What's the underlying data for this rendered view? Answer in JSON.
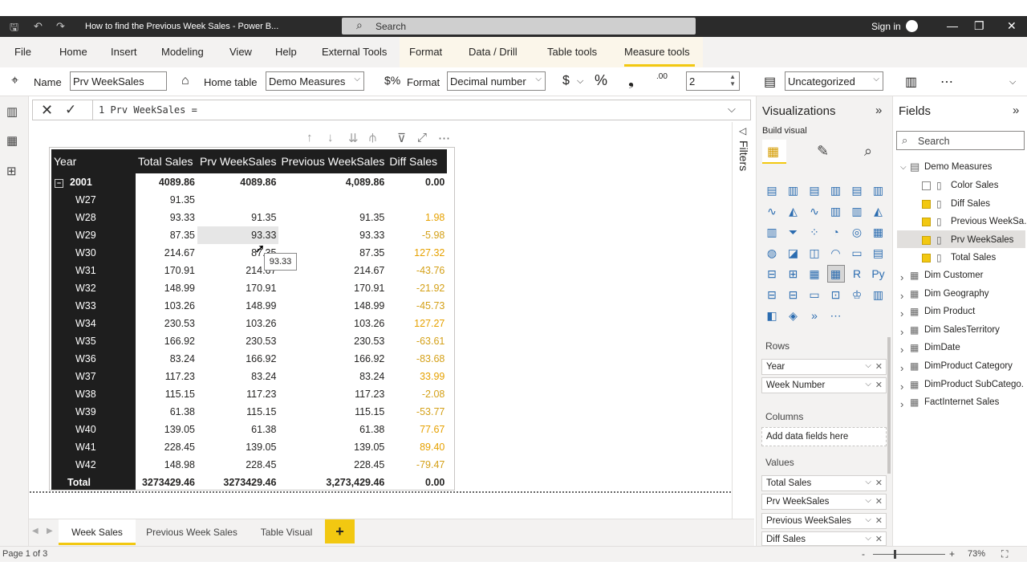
{
  "app": {
    "doc_title": "How to find the Previous Week Sales - Power B...",
    "search_placeholder": "Search",
    "sign_in": "Sign in"
  },
  "menu": [
    "File",
    "Home",
    "Insert",
    "Modeling",
    "View",
    "Help",
    "External Tools",
    "Format",
    "Data / Drill",
    "Table tools",
    "Measure tools"
  ],
  "ribbon": {
    "name_label": "Name",
    "name_value": "Prv WeekSales",
    "home_table_label": "Home table",
    "home_table_value": "Demo Measures",
    "format_label": "Format",
    "format_value": "Decimal number",
    "currency_symbol": "$",
    "percent_symbol": "%",
    "comma_symbol": "❟",
    "decimal_symbol": ".00",
    "decimals_value": "2",
    "category_value": "Uncategorized"
  },
  "formula": "1  Prv WeekSales =",
  "table": {
    "headers": [
      "Year",
      "Total Sales",
      "Prv WeekSales",
      "Previous WeekSales",
      "Diff Sales"
    ],
    "year_row": {
      "label": "2001",
      "total": "4089.86",
      "prv": "4089.86",
      "prev": "4,089.86",
      "diff": "0.00"
    },
    "rows": [
      {
        "label": "W27",
        "total": "91.35",
        "prv": "",
        "prev": "",
        "diff": "",
        "sign": ""
      },
      {
        "label": "W28",
        "total": "93.33",
        "prv": "91.35",
        "prev": "91.35",
        "diff": "1.98",
        "sign": "pos"
      },
      {
        "label": "W29",
        "total": "87.35",
        "prv": "93.33",
        "prev": "93.33",
        "diff": "-5.98",
        "sign": "neg"
      },
      {
        "label": "W30",
        "total": "214.67",
        "prv": "87.35",
        "prev": "87.35",
        "diff": "127.32",
        "sign": "pos"
      },
      {
        "label": "W31",
        "total": "170.91",
        "prv": "214.67",
        "prev": "214.67",
        "diff": "-43.76",
        "sign": "neg"
      },
      {
        "label": "W32",
        "total": "148.99",
        "prv": "170.91",
        "prev": "170.91",
        "diff": "-21.92",
        "sign": "neg"
      },
      {
        "label": "W33",
        "total": "103.26",
        "prv": "148.99",
        "prev": "148.99",
        "diff": "-45.73",
        "sign": "neg"
      },
      {
        "label": "W34",
        "total": "230.53",
        "prv": "103.26",
        "prev": "103.26",
        "diff": "127.27",
        "sign": "pos"
      },
      {
        "label": "W35",
        "total": "166.92",
        "prv": "230.53",
        "prev": "230.53",
        "diff": "-63.61",
        "sign": "neg"
      },
      {
        "label": "W36",
        "total": "83.24",
        "prv": "166.92",
        "prev": "166.92",
        "diff": "-83.68",
        "sign": "neg"
      },
      {
        "label": "W37",
        "total": "117.23",
        "prv": "83.24",
        "prev": "83.24",
        "diff": "33.99",
        "sign": "pos"
      },
      {
        "label": "W38",
        "total": "115.15",
        "prv": "117.23",
        "prev": "117.23",
        "diff": "-2.08",
        "sign": "neg"
      },
      {
        "label": "W39",
        "total": "61.38",
        "prv": "115.15",
        "prev": "115.15",
        "diff": "-53.77",
        "sign": "neg"
      },
      {
        "label": "W40",
        "total": "139.05",
        "prv": "61.38",
        "prev": "61.38",
        "diff": "77.67",
        "sign": "pos"
      },
      {
        "label": "W41",
        "total": "228.45",
        "prv": "139.05",
        "prev": "139.05",
        "diff": "89.40",
        "sign": "pos"
      },
      {
        "label": "W42",
        "total": "148.98",
        "prv": "228.45",
        "prev": "228.45",
        "diff": "-79.47",
        "sign": "neg"
      }
    ],
    "total_row": {
      "label": "Total",
      "total": "3273429.46",
      "prv": "3273429.46",
      "prev": "3,273,429.46",
      "diff": "0.00"
    },
    "tooltip": "93.33"
  },
  "tabs": [
    "Week Sales",
    "Previous Week Sales",
    "Table Visual"
  ],
  "add_tab": "+",
  "status": {
    "page": "Page 1 of 3",
    "zoom": "73%"
  },
  "filters_label": "Filters",
  "viz": {
    "title": "Visualizations",
    "build_visual": "Build visual",
    "rows_title": "Rows",
    "rows": [
      "Year",
      "Week Number"
    ],
    "columns_title": "Columns",
    "columns_placeholder": "Add data fields here",
    "values_title": "Values",
    "values": [
      "Total Sales",
      "Prv WeekSales",
      "Previous WeekSales",
      "Diff Sales"
    ]
  },
  "fields": {
    "title": "Fields",
    "search_placeholder": "Search",
    "demo_measures": "Demo Measures",
    "measures": [
      {
        "name": "Color Sales",
        "checked": false
      },
      {
        "name": "Diff Sales",
        "checked": true
      },
      {
        "name": "Previous WeekSa...",
        "checked": true
      },
      {
        "name": "Prv WeekSales",
        "checked": true
      },
      {
        "name": "Total Sales",
        "checked": true
      }
    ],
    "tables": [
      "Dim Customer",
      "Dim Geography",
      "Dim Product",
      "Dim SalesTerritory",
      "DimDate",
      "DimProduct Category",
      "DimProduct SubCatego...",
      "FactInternet Sales"
    ]
  }
}
